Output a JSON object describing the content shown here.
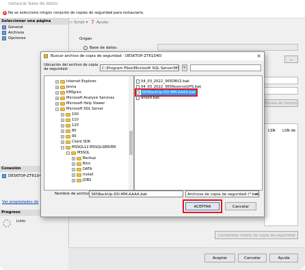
{
  "window": {
    "title": "restaurar base de datos:",
    "warning": "No se seleccione ningún conjunto de copias de seguridad para restaurarlo."
  },
  "left_pane": {
    "select_page_header": "Seleccionar una página",
    "pages": [
      "General",
      "Archivos",
      "Opciones"
    ],
    "connection_header": "Conexión",
    "connection_server": "DESKTOP-ZT61D4",
    "view_props_link": "Ver propiedades de",
    "progress_header": "Progreso",
    "progress_status": "Listo"
  },
  "toolbar": {
    "script": "Script",
    "help": "Ayuda"
  },
  "main": {
    "origen_label": "Origen",
    "base_datos_label": "Base de datos:",
    "col_headers": [
      "LSN",
      "LSN de"
    ],
    "verify_button": "Comprobar medio de copia de seguridad",
    "browse_button": "...",
    "timeline_button": "Escala de tiempo..."
  },
  "footer": {
    "accept": "Aceptar",
    "cancel": "Cancelar",
    "help": "Ayuda"
  },
  "dialog": {
    "title": "Buscar archivo de copia de seguridad - DESKTOP-ZT61D4D",
    "path_label": "Ubicación del archivo de copia de seguridad:",
    "path_value": "C:\\Program Files\\Microsoft SQL Server\\MSSQL12.MSSQLSERVER",
    "tree": [
      {
        "label": "Internet Explorer",
        "level": 0
      },
      {
        "label": "Jenna",
        "level": 0
      },
      {
        "label": "KMSpico",
        "level": 0
      },
      {
        "label": "Microsoft Analysis Services",
        "level": 0
      },
      {
        "label": "Microsoft Help Viewer",
        "level": 0
      },
      {
        "label": "Microsoft SQL Server",
        "level": 0
      },
      {
        "label": "100",
        "level": 1
      },
      {
        "label": "110",
        "level": 1
      },
      {
        "label": "120",
        "level": 1
      },
      {
        "label": "80",
        "level": 1
      },
      {
        "label": "90",
        "level": 1
      },
      {
        "label": "Client SDK",
        "level": 1
      },
      {
        "label": "MSSQL12.MSSQLSERVER",
        "level": 1
      },
      {
        "label": "MSSQL",
        "level": 2
      },
      {
        "label": "Backup",
        "level": 3
      },
      {
        "label": "Binn",
        "level": 3
      },
      {
        "label": "DATA",
        "level": 3
      },
      {
        "label": "Install",
        "level": 3
      },
      {
        "label": "JOBS",
        "level": 3
      }
    ],
    "files": [
      "04_03_2022_365DBV2.bak",
      "04_03_2022_365ReserveGPS.bak",
      "365BackUp-DD-MM-AAAA.bak",
      "ansed.bak"
    ],
    "selected_file_index": 2,
    "filename_label": "Nombre de archivo:",
    "filename_value": "365BackUp-DD-MM-AAAA.bak",
    "filetype_value": "Archivos de copia de seguridad (*.bak",
    "accept": "ACEPTAR",
    "cancel": "Cancelar"
  }
}
